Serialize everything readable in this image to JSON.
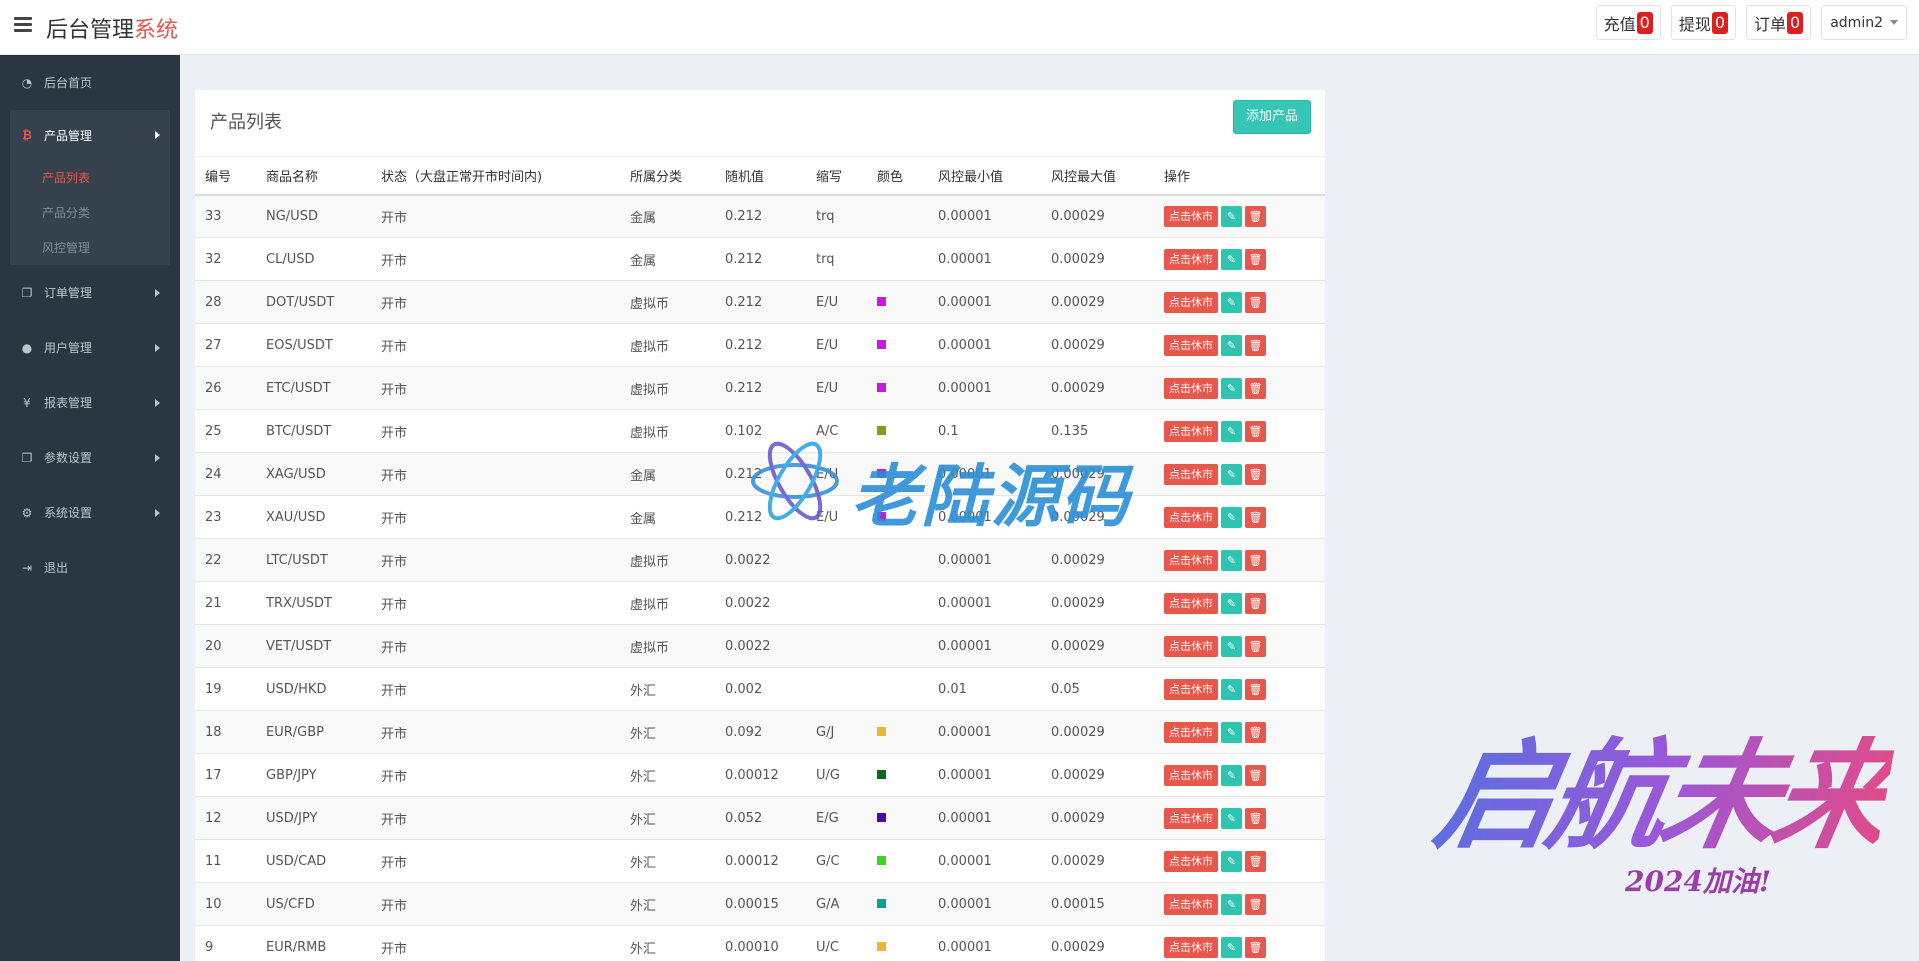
{
  "header": {
    "brand_main": "后台管理",
    "brand_accent": "系统",
    "recharge_label": "充值",
    "recharge_count": "0",
    "withdraw_label": "提现",
    "withdraw_count": "0",
    "order_label": "订单",
    "order_count": "0",
    "user_name": "admin2"
  },
  "sidebar": {
    "home": "后台首页",
    "product_mgmt": "产品管理",
    "sub_product_list": "产品列表",
    "sub_product_category": "产品分类",
    "sub_risk_control": "风控管理",
    "order_mgmt": "订单管理",
    "user_mgmt": "用户管理",
    "report_mgmt": "报表管理",
    "param_settings": "参数设置",
    "system_settings": "系统设置",
    "logout": "退出"
  },
  "main": {
    "title": "产品列表",
    "add_button": "添加产品",
    "columns": [
      "编号",
      "商品名称",
      "状态（大盘正常开市时间内)",
      "所属分类",
      "随机值",
      "缩写",
      "颜色",
      "风控最小值",
      "风控最大值",
      "操作"
    ],
    "close_market_label": "点击休市",
    "rows": [
      {
        "id": "33",
        "name": "NG/USD",
        "status": "开市",
        "category": "金属",
        "random": "0.212",
        "abbr": "trq",
        "color": "",
        "min": "0.00001",
        "max": "0.00029"
      },
      {
        "id": "32",
        "name": "CL/USD",
        "status": "开市",
        "category": "金属",
        "random": "0.212",
        "abbr": "trq",
        "color": "",
        "min": "0.00001",
        "max": "0.00029"
      },
      {
        "id": "28",
        "name": "DOT/USDT",
        "status": "开市",
        "category": "虚拟币",
        "random": "0.212",
        "abbr": "E/U",
        "color": "#c41cd9",
        "min": "0.00001",
        "max": "0.00029"
      },
      {
        "id": "27",
        "name": "EOS/USDT",
        "status": "开市",
        "category": "虚拟币",
        "random": "0.212",
        "abbr": "E/U",
        "color": "#c41cd9",
        "min": "0.00001",
        "max": "0.00029"
      },
      {
        "id": "26",
        "name": "ETC/USDT",
        "status": "开市",
        "category": "虚拟币",
        "random": "0.212",
        "abbr": "E/U",
        "color": "#c41cd9",
        "min": "0.00001",
        "max": "0.00029"
      },
      {
        "id": "25",
        "name": "BTC/USDT",
        "status": "开市",
        "category": "虚拟币",
        "random": "0.102",
        "abbr": "A/C",
        "color": "#8a9a1a",
        "min": "0.1",
        "max": "0.135"
      },
      {
        "id": "24",
        "name": "XAG/USD",
        "status": "开市",
        "category": "金属",
        "random": "0.212",
        "abbr": "E/U",
        "color": "#c41cd9",
        "min": "0.00001",
        "max": "0.00029"
      },
      {
        "id": "23",
        "name": "XAU/USD",
        "status": "开市",
        "category": "金属",
        "random": "0.212",
        "abbr": "E/U",
        "color": "#c41cd9",
        "min": "0.00001",
        "max": "0.00029"
      },
      {
        "id": "22",
        "name": "LTC/USDT",
        "status": "开市",
        "category": "虚拟币",
        "random": "0.0022",
        "abbr": "",
        "color": "",
        "min": "0.00001",
        "max": "0.00029"
      },
      {
        "id": "21",
        "name": "TRX/USDT",
        "status": "开市",
        "category": "虚拟币",
        "random": "0.0022",
        "abbr": "",
        "color": "",
        "min": "0.00001",
        "max": "0.00029"
      },
      {
        "id": "20",
        "name": "VET/USDT",
        "status": "开市",
        "category": "虚拟币",
        "random": "0.0022",
        "abbr": "",
        "color": "",
        "min": "0.00001",
        "max": "0.00029"
      },
      {
        "id": "19",
        "name": "USD/HKD",
        "status": "开市",
        "category": "外汇",
        "random": "0.002",
        "abbr": "",
        "color": "",
        "min": "0.01",
        "max": "0.05"
      },
      {
        "id": "18",
        "name": "EUR/GBP",
        "status": "开市",
        "category": "外汇",
        "random": "0.092",
        "abbr": "G/J",
        "color": "#e8b83a",
        "min": "0.00001",
        "max": "0.00029"
      },
      {
        "id": "17",
        "name": "GBP/JPY",
        "status": "开市",
        "category": "外汇",
        "random": "0.00012",
        "abbr": "U/G",
        "color": "#0c6b1e",
        "min": "0.00001",
        "max": "0.00029"
      },
      {
        "id": "12",
        "name": "USD/JPY",
        "status": "开市",
        "category": "外汇",
        "random": "0.052",
        "abbr": "E/G",
        "color": "#4b0ca6",
        "min": "0.00001",
        "max": "0.00029"
      },
      {
        "id": "11",
        "name": "USD/CAD",
        "status": "开市",
        "category": "外汇",
        "random": "0.00012",
        "abbr": "G/C",
        "color": "#3fd32a",
        "min": "0.00001",
        "max": "0.00029"
      },
      {
        "id": "10",
        "name": "US/CFD",
        "status": "开市",
        "category": "外汇",
        "random": "0.00015",
        "abbr": "G/A",
        "color": "#0e9e94",
        "min": "0.00001",
        "max": "0.00015"
      },
      {
        "id": "9",
        "name": "EUR/RMB",
        "status": "开市",
        "category": "外汇",
        "random": "0.00010",
        "abbr": "U/C",
        "color": "#e8b83a",
        "min": "0.00001",
        "max": "0.00029"
      }
    ]
  },
  "watermarks": {
    "center_text": "老陆源码",
    "corner_text": "启航未来",
    "corner_sub": "2024加油!"
  }
}
